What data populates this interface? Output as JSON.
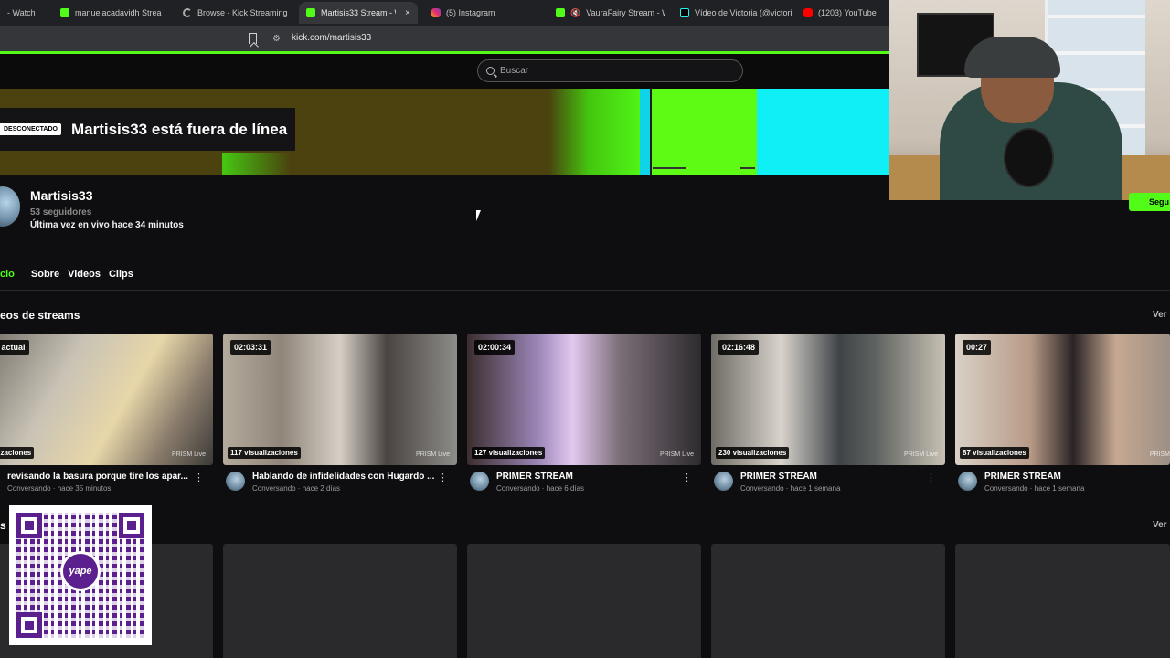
{
  "browser": {
    "tabs": [
      {
        "label": "- Watch",
        "icon": "none"
      },
      {
        "label": "manuelacadavidh Strea",
        "icon": "kick-icon",
        "muted": false
      },
      {
        "label": "Browse - Kick Streaming",
        "icon": "loading-icon"
      },
      {
        "label": "Martisis33 Stream - W",
        "icon": "kick-icon",
        "active": true,
        "close": "×"
      },
      {
        "label": "(5) Instagram",
        "icon": "instagram-icon"
      },
      {
        "label": "VauraFairy Stream - Wa",
        "icon": "kick-icon",
        "muted": true
      },
      {
        "label": "Vídeo de Victoria (@victori",
        "icon": "tiktok-icon"
      },
      {
        "label": "(1203) YouTube",
        "icon": "youtube-icon"
      }
    ],
    "url": "kick.com/martisis33",
    "mute_glyph": "🔇"
  },
  "search": {
    "placeholder": "Buscar"
  },
  "banner": {
    "badge": "DESCONECTADO",
    "title": "Martisis33 está fuera de línea"
  },
  "channel": {
    "name": "Martisis33",
    "followers": "53 seguidores",
    "last_live": "Última vez en vivo hace 34 minutos",
    "follow_label": "Segu"
  },
  "nav_tabs": [
    {
      "label": "cio",
      "active": true
    },
    {
      "label": "Sobre"
    },
    {
      "label": "Videos"
    },
    {
      "label": "Clips"
    }
  ],
  "sections": {
    "videos_title": "eos de streams",
    "see_all": "Ver",
    "clips_title": "s"
  },
  "videos": [
    {
      "duration": "eam actual",
      "views": "isualizaciones",
      "title": "revisando la basura porque tire los apar...",
      "sub": "Conversando · hace 35 minutos",
      "prism": "PRISM Live"
    },
    {
      "duration": "02:03:31",
      "views": "117 visualizaciones",
      "title": "Hablando de infidelidades con Hugardo ...",
      "sub": "Conversando · hace 2 días",
      "prism": "PRISM Live"
    },
    {
      "duration": "02:00:34",
      "views": "127 visualizaciones",
      "title": "PRIMER STREAM",
      "sub": "Conversando · hace 6 días",
      "prism": "PRISM Live"
    },
    {
      "duration": "02:16:48",
      "views": "230 visualizaciones",
      "title": "PRIMER STREAM",
      "sub": "Conversando · hace 1 semana",
      "prism": "PRISM Live"
    },
    {
      "duration": "00:27",
      "views": "87 visualizaciones",
      "title": "PRIMER STREAM",
      "sub": "Conversando · hace 1 semana",
      "prism": "PRISM"
    }
  ],
  "overlay": {
    "qr_brand": "yape"
  },
  "colors": {
    "accent": "#53fc18",
    "background": "#0e0e10",
    "yape": "#5b1f8e"
  }
}
